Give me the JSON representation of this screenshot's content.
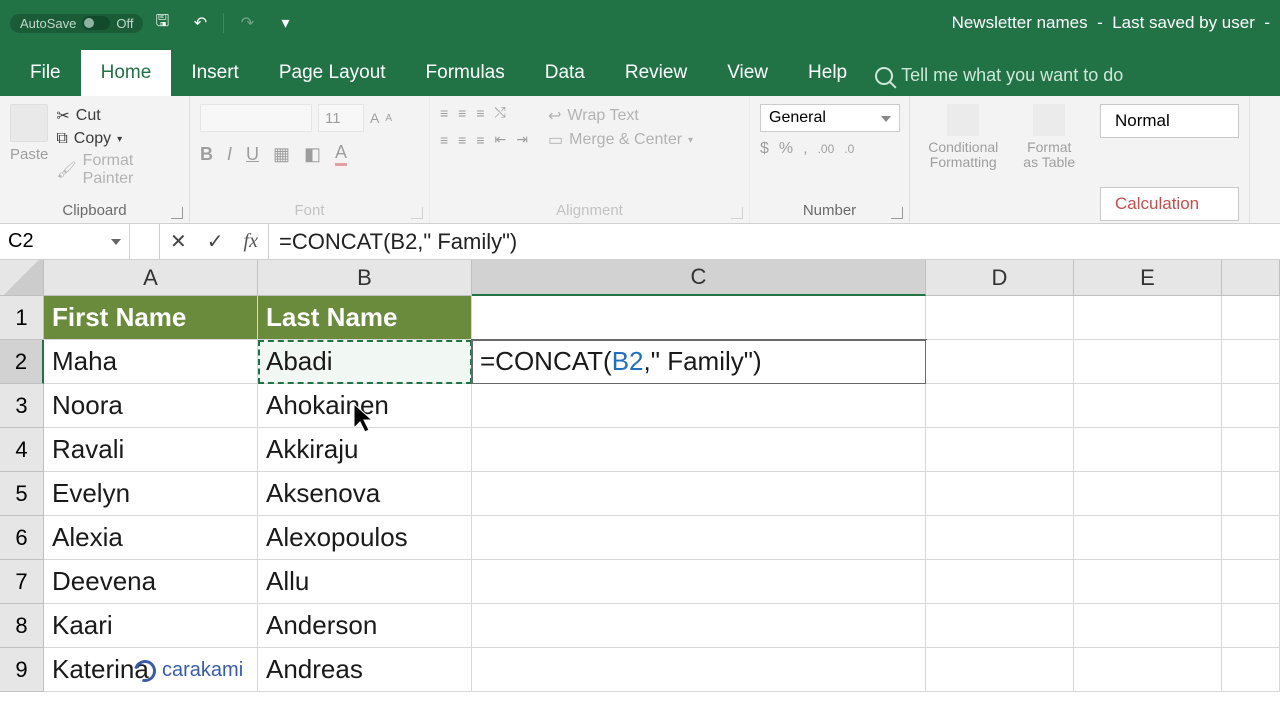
{
  "title_bar": {
    "autosave_label": "AutoSave",
    "autosave_state": "Off",
    "doc_name": "Newsletter names",
    "saved_status": "Last saved by user"
  },
  "tabs": {
    "file": "File",
    "home": "Home",
    "insert": "Insert",
    "page_layout": "Page Layout",
    "formulas": "Formulas",
    "data": "Data",
    "review": "Review",
    "view": "View",
    "help": "Help",
    "tellme": "Tell me what you want to do"
  },
  "ribbon": {
    "clipboard": {
      "label": "Clipboard",
      "paste": "Paste",
      "cut": "Cut",
      "copy": "Copy",
      "format_painter": "Format Painter"
    },
    "font": {
      "label": "Font",
      "size": "11"
    },
    "alignment": {
      "label": "Alignment",
      "wrap": "Wrap Text",
      "merge": "Merge & Center"
    },
    "number": {
      "label": "Number",
      "format": "General"
    },
    "styles": {
      "conditional": "Conditional Formatting",
      "formatas": "Format as Table",
      "normal": "Normal",
      "calculation": "Calculation"
    }
  },
  "fx": {
    "namebox": "C2",
    "formula": "=CONCAT(B2,\" Family\")"
  },
  "cols": [
    "A",
    "B",
    "C",
    "D",
    "E"
  ],
  "headers": {
    "A": "First Name",
    "B": "Last Name"
  },
  "rows": [
    {
      "n": 1
    },
    {
      "n": 2,
      "A": "Maha",
      "B": "Abadi"
    },
    {
      "n": 3,
      "A": "Noora",
      "B": "Ahokainen"
    },
    {
      "n": 4,
      "A": "Ravali",
      "B": "Akkiraju"
    },
    {
      "n": 5,
      "A": "Evelyn",
      "B": "Aksenova"
    },
    {
      "n": 6,
      "A": "Alexia",
      "B": "Alexopoulos"
    },
    {
      "n": 7,
      "A": "Deevena",
      "B": "Allu"
    },
    {
      "n": 8,
      "A": "Kaari",
      "B": "Anderson"
    },
    {
      "n": 9,
      "A": "Katerina",
      "B": "Andreas"
    }
  ],
  "editing_cell": {
    "prefix": "=CONCAT(",
    "ref": "B2",
    "suffix": ",\" Family\")"
  },
  "watermark": "carakami"
}
